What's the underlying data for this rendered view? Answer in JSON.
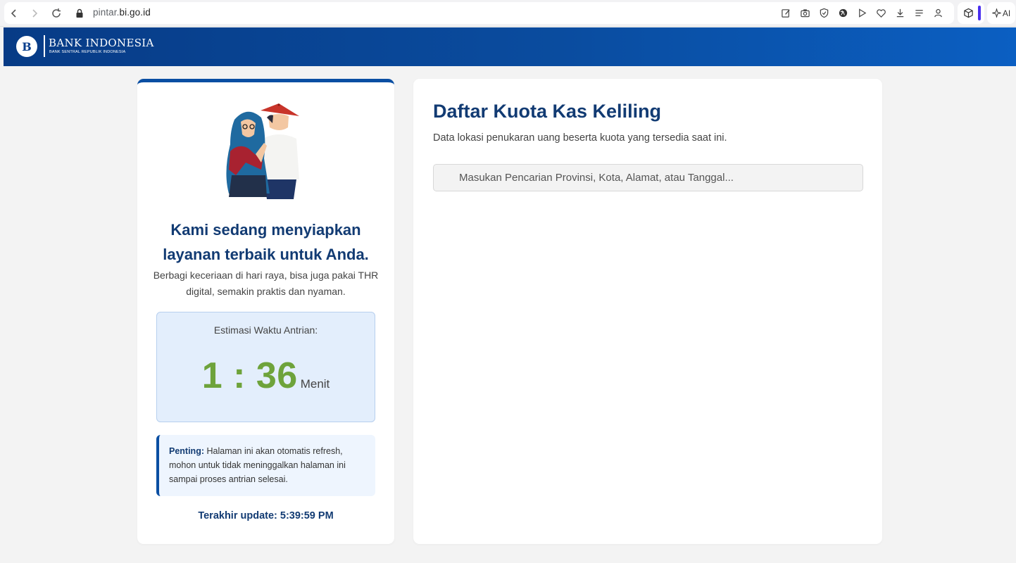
{
  "browser": {
    "url_prefix": "pintar.",
    "url_domain": "bi.go.id",
    "ai_label": "AI"
  },
  "header": {
    "logo_mark": "B",
    "brand_name": "BANK INDONESIA",
    "brand_sub": "BANK SENTRAL REPUBLIK INDONESIA"
  },
  "queue": {
    "headline_line1": "Kami sedang menyiapkan",
    "headline_line2": "layanan terbaik untuk Anda.",
    "subtext": "Berbagi keceriaan di hari raya, bisa juga pakai THR digital, semakin praktis dan nyaman.",
    "estimate_label": "Estimasi Waktu Antrian:",
    "time_value": "1 : 36",
    "time_unit": "Menit",
    "notice_bold": "Penting:",
    "notice_text": "Halaman ini akan otomatis refresh, mohon untuk tidak meninggalkan halaman ini sampai proses antrian selesai.",
    "last_update": "Terakhir update: 5:39:59 PM"
  },
  "main": {
    "title": "Daftar Kuota Kas Keliling",
    "subtitle": "Data lokasi penukaran uang beserta kuota yang tersedia saat ini.",
    "search_placeholder": "Masukan Pencarian Provinsi, Kota, Alamat, atau Tanggal..."
  },
  "colors": {
    "brand_blue": "#0a4ea2",
    "heading_navy": "#123b73",
    "timer_green": "#6ea33b",
    "queue_box_bg": "#e3eefc",
    "extension_purple": "#4a2ff0"
  },
  "icons": [
    "back-icon",
    "forward-icon",
    "reload-icon",
    "lock-icon",
    "edit-icon",
    "camera-icon",
    "shield-icon",
    "translate-icon",
    "play-icon",
    "heart-icon",
    "download-icon",
    "menu-icon",
    "account-icon",
    "extension-cube-icon",
    "ai-sparkle-icon"
  ]
}
